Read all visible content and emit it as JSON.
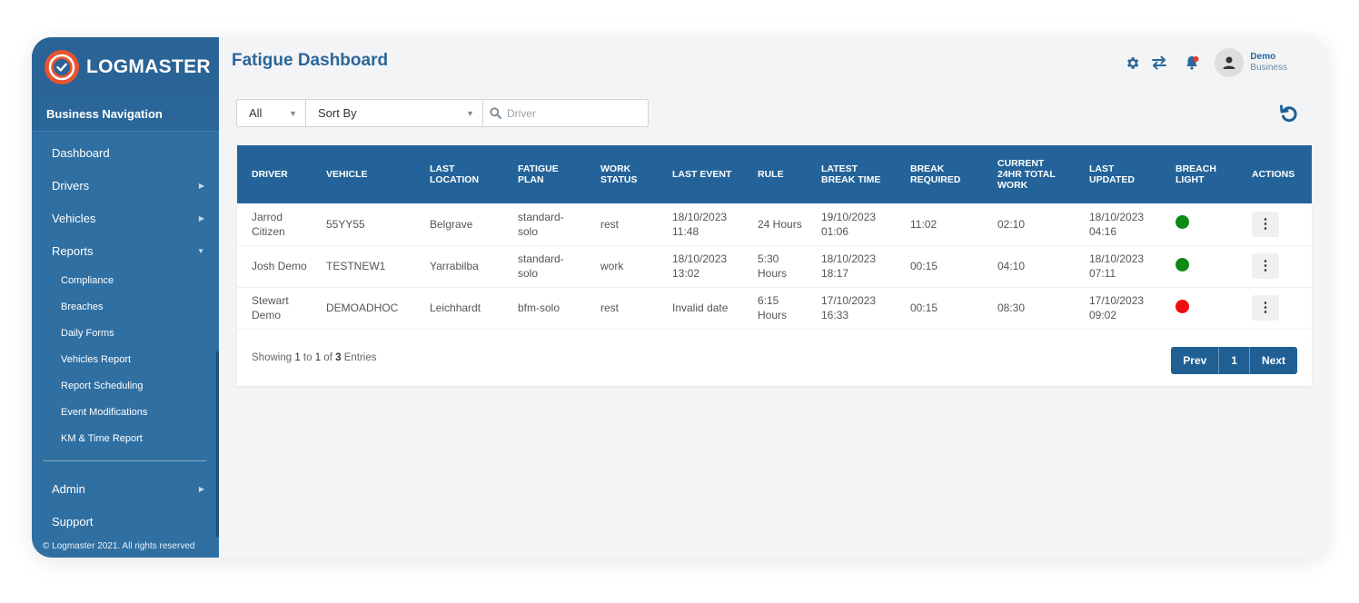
{
  "brand": {
    "name": "LOGMASTER",
    "logo_color": "#e8542f"
  },
  "sidebar": {
    "heading": "Business Navigation",
    "items": [
      {
        "label": "Dashboard"
      },
      {
        "label": "Drivers"
      },
      {
        "label": "Vehicles"
      },
      {
        "label": "Reports"
      }
    ],
    "report_items": [
      {
        "label": "Compliance"
      },
      {
        "label": "Breaches"
      },
      {
        "label": "Daily Forms"
      },
      {
        "label": "Vehicles Report"
      },
      {
        "label": "Report Scheduling"
      },
      {
        "label": "Event Modifications"
      },
      {
        "label": "KM & Time Report"
      }
    ],
    "bottom_items": [
      {
        "label": "Admin"
      },
      {
        "label": "Support"
      }
    ],
    "copyright": "© Logmaster 2021. All rights reserved"
  },
  "header": {
    "title": "Fatigue Dashboard",
    "icons": [
      "gear-icon",
      "swap-arrows-icon",
      "bell-icon",
      "user-icon"
    ],
    "user": {
      "name": "Demo",
      "role": "Business"
    }
  },
  "filters": {
    "status_value": "All",
    "sort_value": "Sort By",
    "search_placeholder": "Driver"
  },
  "table": {
    "headers": [
      "DRIVER",
      "VEHICLE",
      "LAST LOCATION",
      "FATIGUE PLAN",
      "WORK STATUS",
      "LAST EVENT",
      "RULE",
      "LATEST BREAK TIME",
      "BREAK REQUIRED",
      "CURRENT 24HR TOTAL WORK",
      "LAST UPDATED",
      "BREACH LIGHT",
      "ACTIONS"
    ],
    "rows": [
      {
        "driver": "Jarrod Citizen",
        "vehicle": "55YY55",
        "location": "Belgrave",
        "plan": "standard-solo",
        "status": "rest",
        "last_event": "18/10/2023 11:48",
        "rule": "24 Hours",
        "break_time": "19/10/2023 01:06",
        "break_required": "11:02",
        "total_work": "02:10",
        "last_updated": "18/10/2023 04:16",
        "breach_color": "#0e8a16"
      },
      {
        "driver": "Josh Demo",
        "vehicle": "TESTNEW1",
        "location": "Yarrabilba",
        "plan": "standard-solo",
        "status": "work",
        "last_event": "18/10/2023 13:02",
        "rule": "5:30 Hours",
        "break_time": "18/10/2023 18:17",
        "break_required": "00:15",
        "total_work": "04:10",
        "last_updated": "18/10/2023 07:11",
        "breach_color": "#0e8a16"
      },
      {
        "driver": "Stewart Demo",
        "vehicle": "DEMOADHOC",
        "location": "Leichhardt",
        "plan": "bfm-solo",
        "status": "rest",
        "last_event": "Invalid date",
        "rule": "6:15 Hours",
        "break_time": "17/10/2023 16:33",
        "break_required": "00:15",
        "total_work": "08:30",
        "last_updated": "17/10/2023 09:02",
        "breach_color": "#f00d0d"
      }
    ]
  },
  "footer": {
    "showing_prefix": "Showing ",
    "from": "1",
    "to_word": " to ",
    "to": "1",
    "of_word": " of ",
    "total": "3",
    "suffix": " Entries"
  },
  "pagination": {
    "prev": "Prev",
    "page": "1",
    "next": "Next"
  },
  "colors": {
    "primary": "#2b6699",
    "sidebar": "#2f6fa2",
    "table_header": "#236399"
  }
}
